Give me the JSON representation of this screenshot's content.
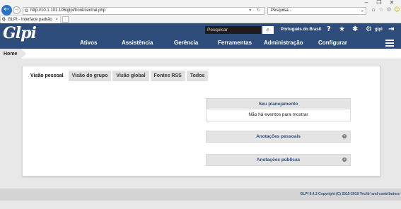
{
  "browser": {
    "url": "http://10.1.101.106/glpi/front/central.php",
    "search_placeholder": "Pesquisa...",
    "tab_title": "GLPI - Interface padrão",
    "window_controls": [
      "–",
      "❐",
      "✕"
    ],
    "icons": [
      "home-icon",
      "star-icon",
      "gear-icon",
      "smiley-icon"
    ]
  },
  "header": {
    "logo_text": "Glpi",
    "search_placeholder": "Pesquisar",
    "language": "Português do Brasil",
    "user_label": "glpi",
    "menu": [
      "Ativos",
      "Assistência",
      "Gerência",
      "Ferramentas",
      "Administração",
      "Configurar"
    ]
  },
  "breadcrumb": {
    "home": "Home"
  },
  "tabs": [
    "Visão pessoal",
    "Visão do grupo",
    "Visão global",
    "Fontes RSS",
    "Todos"
  ],
  "active_tab": "Visão pessoal",
  "planning": {
    "title": "Seu planejamento",
    "empty_message": "Não há eventos para mostrar"
  },
  "personal_notes": {
    "title": "Anotações pessoais"
  },
  "public_notes": {
    "title": "Anotações públicas"
  },
  "footer": {
    "copyright": "GLPI 9.4.3 Copyright (C) 2015-2019 Teclib' and contributors"
  },
  "colors": {
    "header": "#2e4d7b",
    "accent": "#2e4d7b"
  }
}
